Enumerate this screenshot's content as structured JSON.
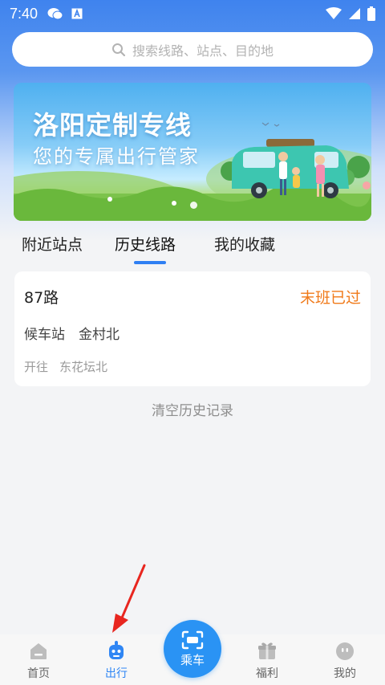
{
  "status_bar": {
    "time": "7:40",
    "icons": [
      "wechat-icon",
      "app-icon",
      "wifi-icon",
      "signal-icon",
      "battery-icon"
    ]
  },
  "search": {
    "placeholder": "搜索线路、站点、目的地",
    "icon": "search-icon"
  },
  "banner": {
    "title": "洛阳定制专线",
    "subtitle": "您的专属出行管家"
  },
  "tabs": [
    {
      "label": "附近站点",
      "active": false
    },
    {
      "label": "历史线路",
      "active": true
    },
    {
      "label": "我的收藏",
      "active": false
    }
  ],
  "history": {
    "route_name": "87路",
    "status": "末班已过",
    "stop_label": "候车站",
    "stop_name": "金村北",
    "direction_label": "开往",
    "direction_name": "东花坛北"
  },
  "clear_label": "清空历史记录",
  "bottom_nav": {
    "items": [
      {
        "label": "首页",
        "icon": "home-icon"
      },
      {
        "label": "出行",
        "icon": "robot-icon",
        "active": true
      },
      {
        "label": "福利",
        "icon": "gift-icon"
      },
      {
        "label": "我的",
        "icon": "face-icon"
      }
    ],
    "ride_label": "乘车"
  },
  "colors": {
    "accent": "#2f86f4",
    "status_orange": "#f07a1a",
    "arrow_red": "#e8261f"
  }
}
